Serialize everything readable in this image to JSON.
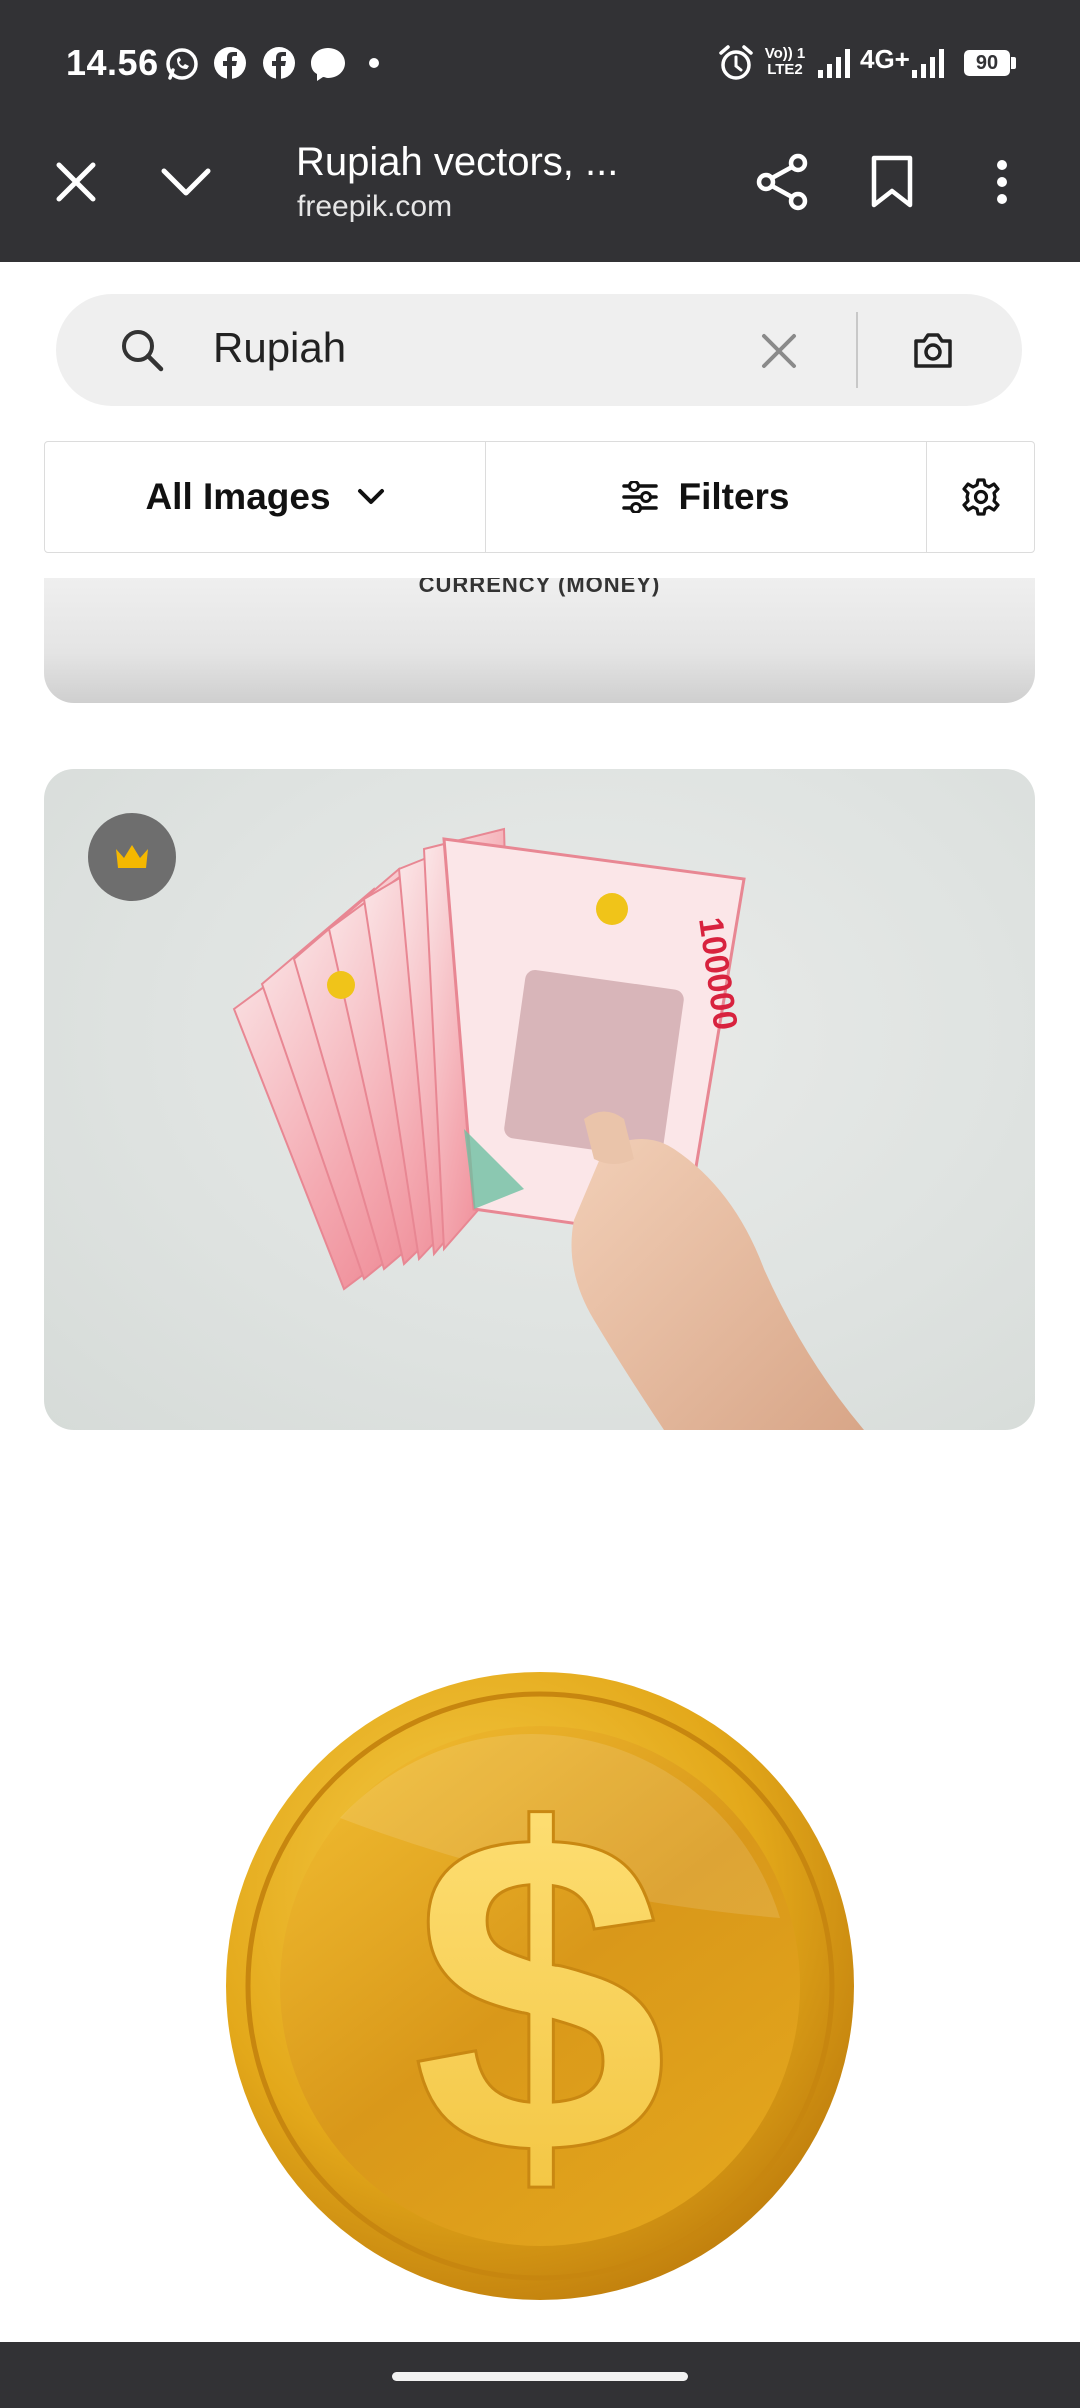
{
  "status_bar": {
    "time": "14.56",
    "network_label": "4G+",
    "volte_label_top": "Vo)) 1",
    "volte_label_bottom": "LTE2",
    "battery": "90",
    "notification_icons": [
      "whatsapp-icon",
      "facebook-icon",
      "facebook-icon",
      "messenger-icon",
      "dot-icon"
    ],
    "right_icons": [
      "alarm-icon",
      "volte-icon",
      "signal-icon",
      "signal-icon",
      "battery-icon"
    ]
  },
  "toolbar": {
    "page_title": "Rupiah vectors, ...",
    "domain": "freepik.com",
    "icons": [
      "close-icon",
      "chevron-down-icon",
      "share-icon",
      "bookmark-icon",
      "more-vert-icon"
    ]
  },
  "search": {
    "query": "Rupiah",
    "icons": [
      "search-icon",
      "clear-icon",
      "camera-icon"
    ]
  },
  "filters": {
    "type_select": "All Images",
    "filters_label": "Filters",
    "icons": [
      "chevron-down-icon",
      "sliders-icon",
      "settings-icon"
    ]
  },
  "results": [
    {
      "caption": "CURRENCY (MONEY)"
    },
    {
      "badge": "crown-icon",
      "badge_color": "#f5b800",
      "banknote_value": "100000"
    },
    {
      "symbol": "$"
    }
  ],
  "colors": {
    "chrome": "#323235",
    "search_bg": "#efefef",
    "coin_gold": "#e3a81a",
    "banknote_red": "#ef8a95"
  }
}
